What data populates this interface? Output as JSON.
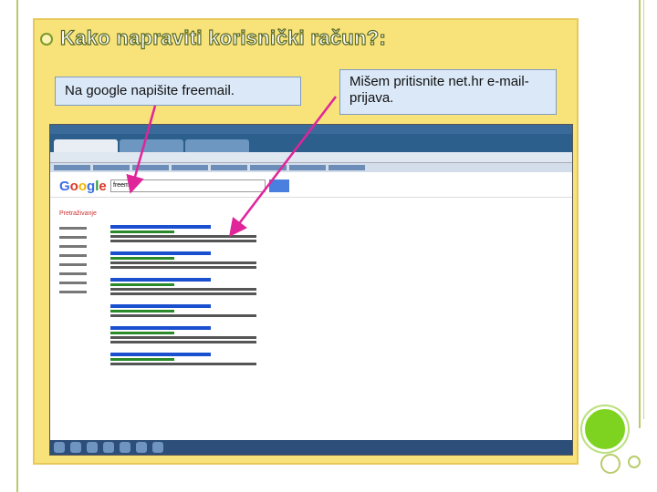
{
  "slide": {
    "title": "Kako napraviti korisnički račun?:",
    "callout_left": "Na google napišite freemail.",
    "callout_right": "Mišem pritisnite net.hr e-mail-prijava."
  },
  "screenshot": {
    "logo": "Google",
    "search_value": "freemail",
    "sidebar_label": "Pretraživanje"
  },
  "colors": {
    "panel": "#f8e27a",
    "callout": "#dbe8f8",
    "arrow": "#e0249a",
    "accent": "#7ed321"
  }
}
